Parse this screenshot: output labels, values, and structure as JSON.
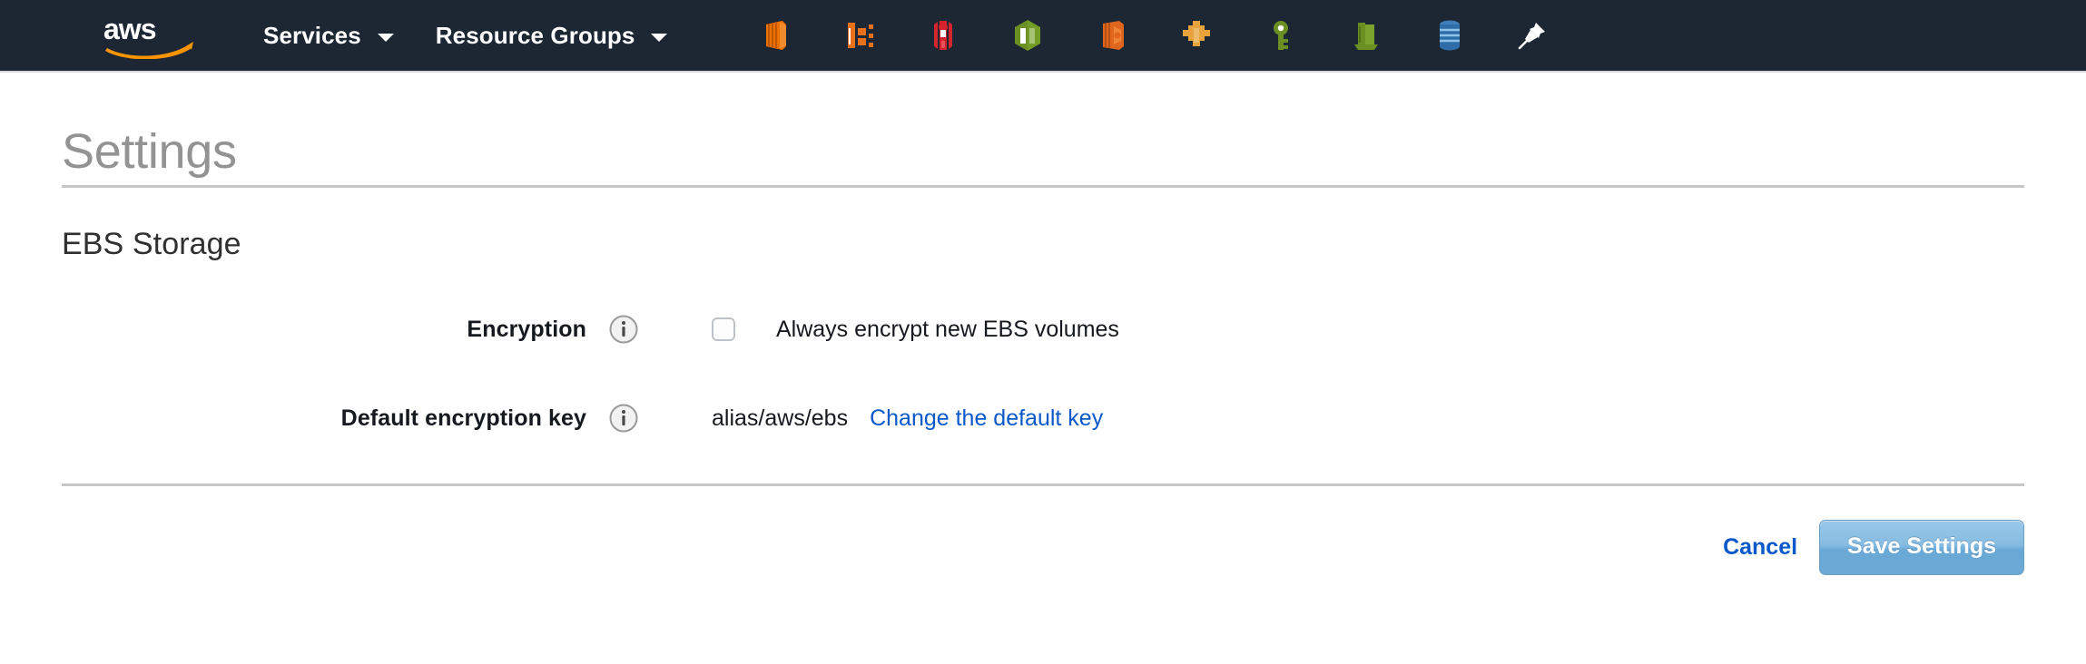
{
  "navbar": {
    "logo_alt": "aws",
    "links": [
      {
        "label": "Services"
      },
      {
        "label": "Resource Groups"
      }
    ],
    "service_icons": [
      {
        "name": "ec2-icon",
        "color": "#ed7100"
      },
      {
        "name": "ecs-icon",
        "color": "#e8711a"
      },
      {
        "name": "elastic-beanstalk-icon",
        "color": "#d6242d"
      },
      {
        "name": "lambda-icon",
        "color": "#6b8f23"
      },
      {
        "name": "ebs-icon",
        "color": "#e0661d"
      },
      {
        "name": "step-functions-icon",
        "color": "#e8a33d"
      },
      {
        "name": "key-management-icon",
        "color": "#6b8f23"
      },
      {
        "name": "s3-icon",
        "color": "#6b8f23"
      },
      {
        "name": "rds-icon",
        "color": "#2f6da8"
      }
    ],
    "pin_icon": {
      "name": "pin-icon",
      "color": "#ffffff"
    },
    "background_color": "#1d2633"
  },
  "page": {
    "title": "Settings",
    "section_title": "EBS Storage"
  },
  "form": {
    "encryption": {
      "label": "Encryption",
      "info_icon": "info-icon",
      "checkbox_checked": false,
      "checkbox_label": "Always encrypt new EBS volumes"
    },
    "default_key": {
      "label": "Default encryption key",
      "info_icon": "info-icon",
      "value": "alias/aws/ebs",
      "link_label": "Change the default key"
    }
  },
  "footer": {
    "cancel_label": "Cancel",
    "save_label": "Save Settings",
    "link_color": "#0a58ca",
    "save_button_color": "#87bce2"
  }
}
